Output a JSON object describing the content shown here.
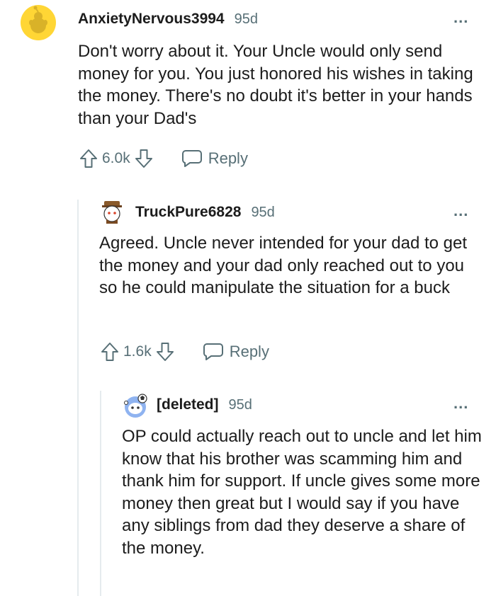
{
  "comments": [
    {
      "username": "AnxietyNervous3994",
      "age": "95d",
      "more": "...",
      "text": "Don't worry about it. Your Uncle would only send money for you. You just honored his wishes in taking the money. There's no doubt it's better in your hands than your Dad's",
      "score": "6.0k",
      "reply_label": "Reply"
    },
    {
      "username": "TruckPure6828",
      "age": "95d",
      "more": "...",
      "text": "Agreed. Uncle never intended for your dad to get the money and your dad only reached out to you so he could manipulate the situation for a buck",
      "score": "1.6k",
      "reply_label": "Reply"
    },
    {
      "username": "[deleted]",
      "age": "95d",
      "more": "...",
      "text": "OP could actually reach out to uncle and let him know that his brother was scamming him and thank him for support. If uncle gives some more money then great but I would say if you have any siblings from dad they deserve a share of the money."
    }
  ]
}
